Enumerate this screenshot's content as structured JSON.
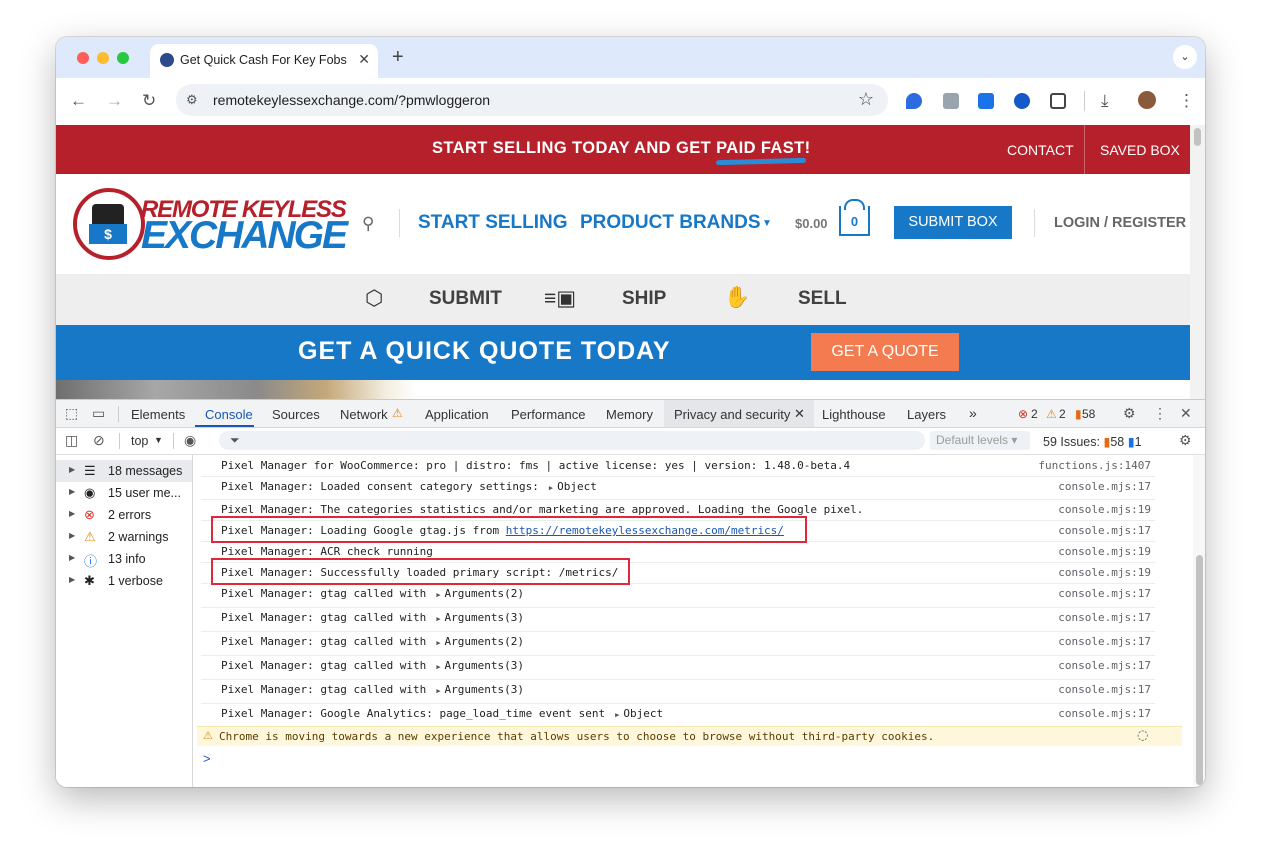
{
  "browser": {
    "tab_title": "Get Quick Cash For Key Fobs",
    "url": "remotekeylessexchange.com/?pmwloggeron"
  },
  "site": {
    "banner": {
      "message": "START SELLING TODAY AND GET PAID FAST!",
      "contact": "CONTACT",
      "saved_box": "SAVED BOX"
    },
    "logo": {
      "line1": "REMOTE KEYLESS",
      "line2": "EXCHANGE",
      "badge": "$"
    },
    "nav": {
      "start_selling": "START SELLING",
      "product_brands": "PRODUCT BRANDS",
      "cart_amount": "$0.00",
      "cart_count": "0",
      "submit_box": "SUBMIT BOX",
      "login": "LOGIN / REGISTER"
    },
    "steps": [
      "SUBMIT",
      "SHIP",
      "SELL"
    ],
    "quote": {
      "title": "GET A QUICK QUOTE TODAY",
      "button": "GET A QUOTE"
    }
  },
  "devtools": {
    "tabs": [
      "Elements",
      "Console",
      "Sources",
      "Network",
      "Application",
      "Performance",
      "Memory",
      "Privacy and security",
      "Lighthouse",
      "Layers"
    ],
    "errors": "2",
    "warnings": "2",
    "info": "58",
    "context": "top",
    "levels": "Default levels",
    "issues_label": "59 Issues:",
    "issues_count": "58",
    "issues_info": "1",
    "sidebar": [
      {
        "label": "18 messages",
        "icon": "list-icon"
      },
      {
        "label": "15 user me...",
        "icon": "user-icon"
      },
      {
        "label": "2 errors",
        "icon": "error-icon"
      },
      {
        "label": "2 warnings",
        "icon": "warning-icon"
      },
      {
        "label": "13 info",
        "icon": "info-icon"
      },
      {
        "label": "1 verbose",
        "icon": "bug-icon"
      }
    ],
    "logs": [
      {
        "text": "Pixel Manager for WooCommerce: pro | distro: fms | active license: yes | version: 1.48.0-beta.4",
        "src": "functions.js:1407"
      },
      {
        "text": "Pixel Manager: Loaded consent category settings:",
        "arg": "Object",
        "src": "console.mjs:17"
      },
      {
        "text": "Pixel Manager: The categories statistics and/or marketing are approved. Loading the Google pixel.",
        "src": "console.mjs:19"
      },
      {
        "text": "Pixel Manager: Loading Google gtag.js from ",
        "link": "https://remotekeylessexchange.com/metrics/",
        "src": "console.mjs:17"
      },
      {
        "text": "Pixel Manager: ACR check running",
        "src": "console.mjs:19"
      },
      {
        "text": "Pixel Manager: Successfully loaded primary script: /metrics/",
        "src": "console.mjs:19"
      },
      {
        "text": "Pixel Manager: gtag called with",
        "arg": "Arguments(2)",
        "src": "console.mjs:17"
      },
      {
        "text": "Pixel Manager: gtag called with",
        "arg": "Arguments(3)",
        "src": "console.mjs:17"
      },
      {
        "text": "Pixel Manager: gtag called with",
        "arg": "Arguments(2)",
        "src": "console.mjs:17"
      },
      {
        "text": "Pixel Manager: gtag called with",
        "arg": "Arguments(3)",
        "src": "console.mjs:17"
      },
      {
        "text": "Pixel Manager: gtag called with",
        "arg": "Arguments(3)",
        "src": "console.mjs:17"
      },
      {
        "text": "Pixel Manager: Google Analytics: page_load_time event sent",
        "arg": "Object",
        "src": "console.mjs:17"
      }
    ],
    "warning_msg": "Chrome is moving towards a new experience that allows users to choose to browse without third-party cookies.",
    "prompt": ">"
  },
  "colors": {
    "brand_red": "#b5202b",
    "brand_blue": "#1778c7",
    "quote_orange": "#f47b4f",
    "highlight_red": "#e0283a"
  }
}
